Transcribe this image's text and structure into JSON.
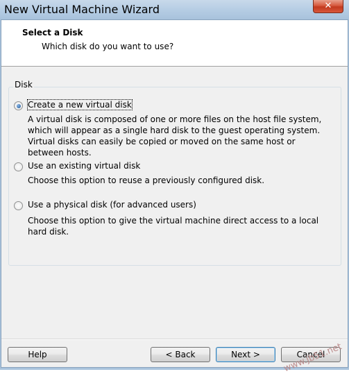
{
  "window": {
    "title": "New Virtual Machine Wizard",
    "close_symbol": "✕"
  },
  "header": {
    "title": "Select a Disk",
    "subtitle": "Which disk do you want to use?"
  },
  "group": {
    "label": "Disk"
  },
  "options": [
    {
      "label": "Create a new virtual disk",
      "description": "A virtual disk is composed of one or more files on the host file system, which will appear as a single hard disk to the guest operating system. Virtual disks can easily be copied or moved on the same host or between hosts.",
      "selected": true
    },
    {
      "label": "Use an existing virtual disk",
      "description": "Choose this option to reuse a previously configured disk.",
      "selected": false
    },
    {
      "label": "Use a physical disk (for advanced users)",
      "description": "Choose this option to give the virtual machine direct access to a local hard disk.",
      "selected": false
    }
  ],
  "buttons": {
    "help": "Help",
    "back": "< Back",
    "next": "Next >",
    "cancel": "Cancel"
  },
  "watermark": "www.jb51.net"
}
